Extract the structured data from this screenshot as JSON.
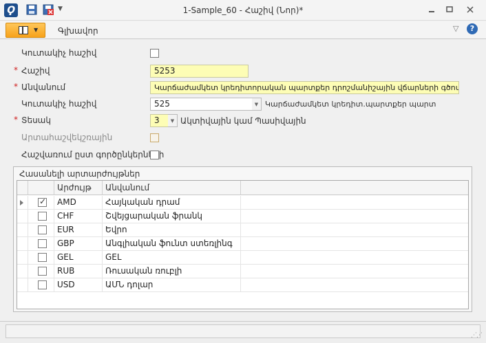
{
  "window": {
    "title": "1-Sample_60 - Հաշիվ (Նոր)*",
    "minimize_icon": "minimize-icon",
    "restore_icon": "restore-icon",
    "close_icon": "close-icon"
  },
  "ribbon": {
    "tab_main": "Գլխավոր"
  },
  "form": {
    "control_account_label": "Կուտակիչ հաշիվ",
    "account_label": "Հաշիվ",
    "account_value": "5253",
    "name_label": "Անվանում",
    "name_value": "Կարճաժամկետ կրեդիտորական պարտքեր դրոշմանիշային վճարների գծով",
    "parent_account_label": "Կուտակիչ հաշիվ",
    "parent_account_value": "525",
    "parent_account_desc": "Կարճաժամկետ կրեդիտ.պարտքեր պարտ",
    "type_label": "Տեսակ",
    "type_value": "3",
    "type_desc": "Ակտիվային կամ Պասիվային",
    "offbalance_label": "Արտահաշվեկշռային",
    "by_ops_label": "Հաշվառում ըստ գործընկերների"
  },
  "group": {
    "title": "Հասանելի արտարժույթներ",
    "columns": [
      "Արժույթ",
      "Անվանում"
    ],
    "rows": [
      {
        "code": "AMD",
        "name": "Հայկական դրամ",
        "checked": true,
        "current": true
      },
      {
        "code": "CHF",
        "name": "Շվեյցարական ֆրանկ",
        "checked": false,
        "current": false
      },
      {
        "code": "EUR",
        "name": "Եվրո",
        "checked": false,
        "current": false
      },
      {
        "code": "GBP",
        "name": "Անգլիական ֆունտ ստեռլինգ",
        "checked": false,
        "current": false
      },
      {
        "code": "GEL",
        "name": "GEL",
        "checked": false,
        "current": false
      },
      {
        "code": "RUB",
        "name": "Ռուսական ռուբլի",
        "checked": false,
        "current": false
      },
      {
        "code": "USD",
        "name": "ԱՄՆ դոլար",
        "checked": false,
        "current": false
      }
    ]
  },
  "colors": {
    "required": "#d02020",
    "highlight_input": "#fdfdb5",
    "file_button": "#f7a21a",
    "help_icon": "#2f6ab5"
  }
}
